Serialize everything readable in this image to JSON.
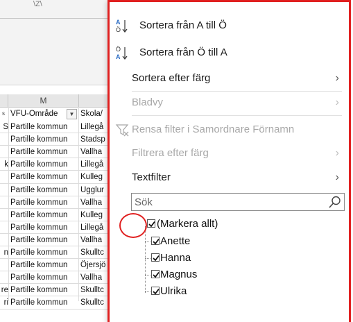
{
  "sheet": {
    "column_letter": "M",
    "header_left": "VFU-Område",
    "header_right": "Skola/",
    "top_fragment": "\\Z\\",
    "rows": [
      {
        "prefix": "S",
        "area": "Partille kommun",
        "school": "Lillegå"
      },
      {
        "prefix": "",
        "area": "Partille kommun",
        "school": "Stadsp"
      },
      {
        "prefix": "",
        "area": "Partille kommun",
        "school": "Vallha"
      },
      {
        "prefix": "k",
        "area": "Partille kommun",
        "school": "Lillegå"
      },
      {
        "prefix": "",
        "area": "Partille kommun",
        "school": "Kulleg"
      },
      {
        "prefix": "",
        "area": "Partille kommun",
        "school": "Ugglur"
      },
      {
        "prefix": "",
        "area": "Partille kommun",
        "school": "Vallha"
      },
      {
        "prefix": "",
        "area": "Partille kommun",
        "school": "Kulleg"
      },
      {
        "prefix": "",
        "area": "Partille kommun",
        "school": "Lillegå"
      },
      {
        "prefix": "",
        "area": "Partille kommun",
        "school": "Vallha"
      },
      {
        "prefix": "n",
        "area": "Partille kommun",
        "school": "Skulltc"
      },
      {
        "prefix": "",
        "area": "Partille kommun",
        "school": "Öjersjö"
      },
      {
        "prefix": "",
        "area": "Partille kommun",
        "school": "Vallha"
      },
      {
        "prefix": "re",
        "area": "Partille kommun",
        "school": "Skulltc"
      },
      {
        "prefix": "ri",
        "area": "Partille kommun",
        "school": "Skulltc"
      }
    ]
  },
  "menu": {
    "sort_az": "Sortera från A till Ö",
    "sort_za": "Sortera från Ö till A",
    "sort_by_color": "Sortera efter färg",
    "sheet_view": "Bladvy",
    "clear_filter": "Rensa filter i Samordnare Förnamn",
    "filter_by_color": "Filtrera efter färg",
    "text_filter": "Textfilter",
    "search_placeholder": "Sök",
    "select_all": "(Markera allt)",
    "values": [
      "Anette",
      "Hanna",
      "Magnus",
      "Ulrika"
    ]
  },
  "colors": {
    "highlight": "#e02020",
    "disabled_text": "#a8a8a8",
    "sort_icon_blue": "#2b6cc4"
  },
  "icons": {
    "sort_az": "sort-ascending-icon",
    "sort_za": "sort-descending-icon",
    "clear_filter": "clear-filter-icon",
    "submenu": "chevron-right-icon",
    "search": "search-icon",
    "checkbox": "checkbox-checked-icon"
  }
}
